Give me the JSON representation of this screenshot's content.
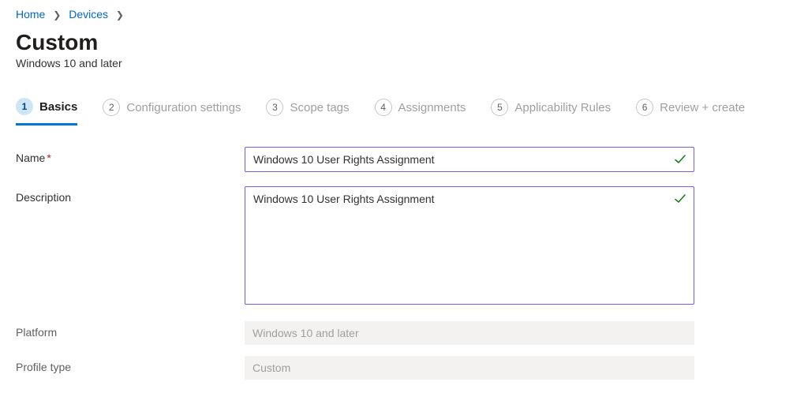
{
  "breadcrumb": {
    "items": [
      {
        "label": "Home"
      },
      {
        "label": "Devices"
      }
    ]
  },
  "header": {
    "title": "Custom",
    "subtitle": "Windows 10 and later"
  },
  "wizard": {
    "steps": [
      {
        "num": "1",
        "label": "Basics"
      },
      {
        "num": "2",
        "label": "Configuration settings"
      },
      {
        "num": "3",
        "label": "Scope tags"
      },
      {
        "num": "4",
        "label": "Assignments"
      },
      {
        "num": "5",
        "label": "Applicability Rules"
      },
      {
        "num": "6",
        "label": "Review + create"
      }
    ]
  },
  "form": {
    "name_label": "Name",
    "name_value": "Windows 10 User Rights Assignment",
    "description_label": "Description",
    "description_value": "Windows 10 User Rights Assignment",
    "platform_label": "Platform",
    "platform_value": "Windows 10 and later",
    "profile_type_label": "Profile type",
    "profile_type_value": "Custom"
  }
}
